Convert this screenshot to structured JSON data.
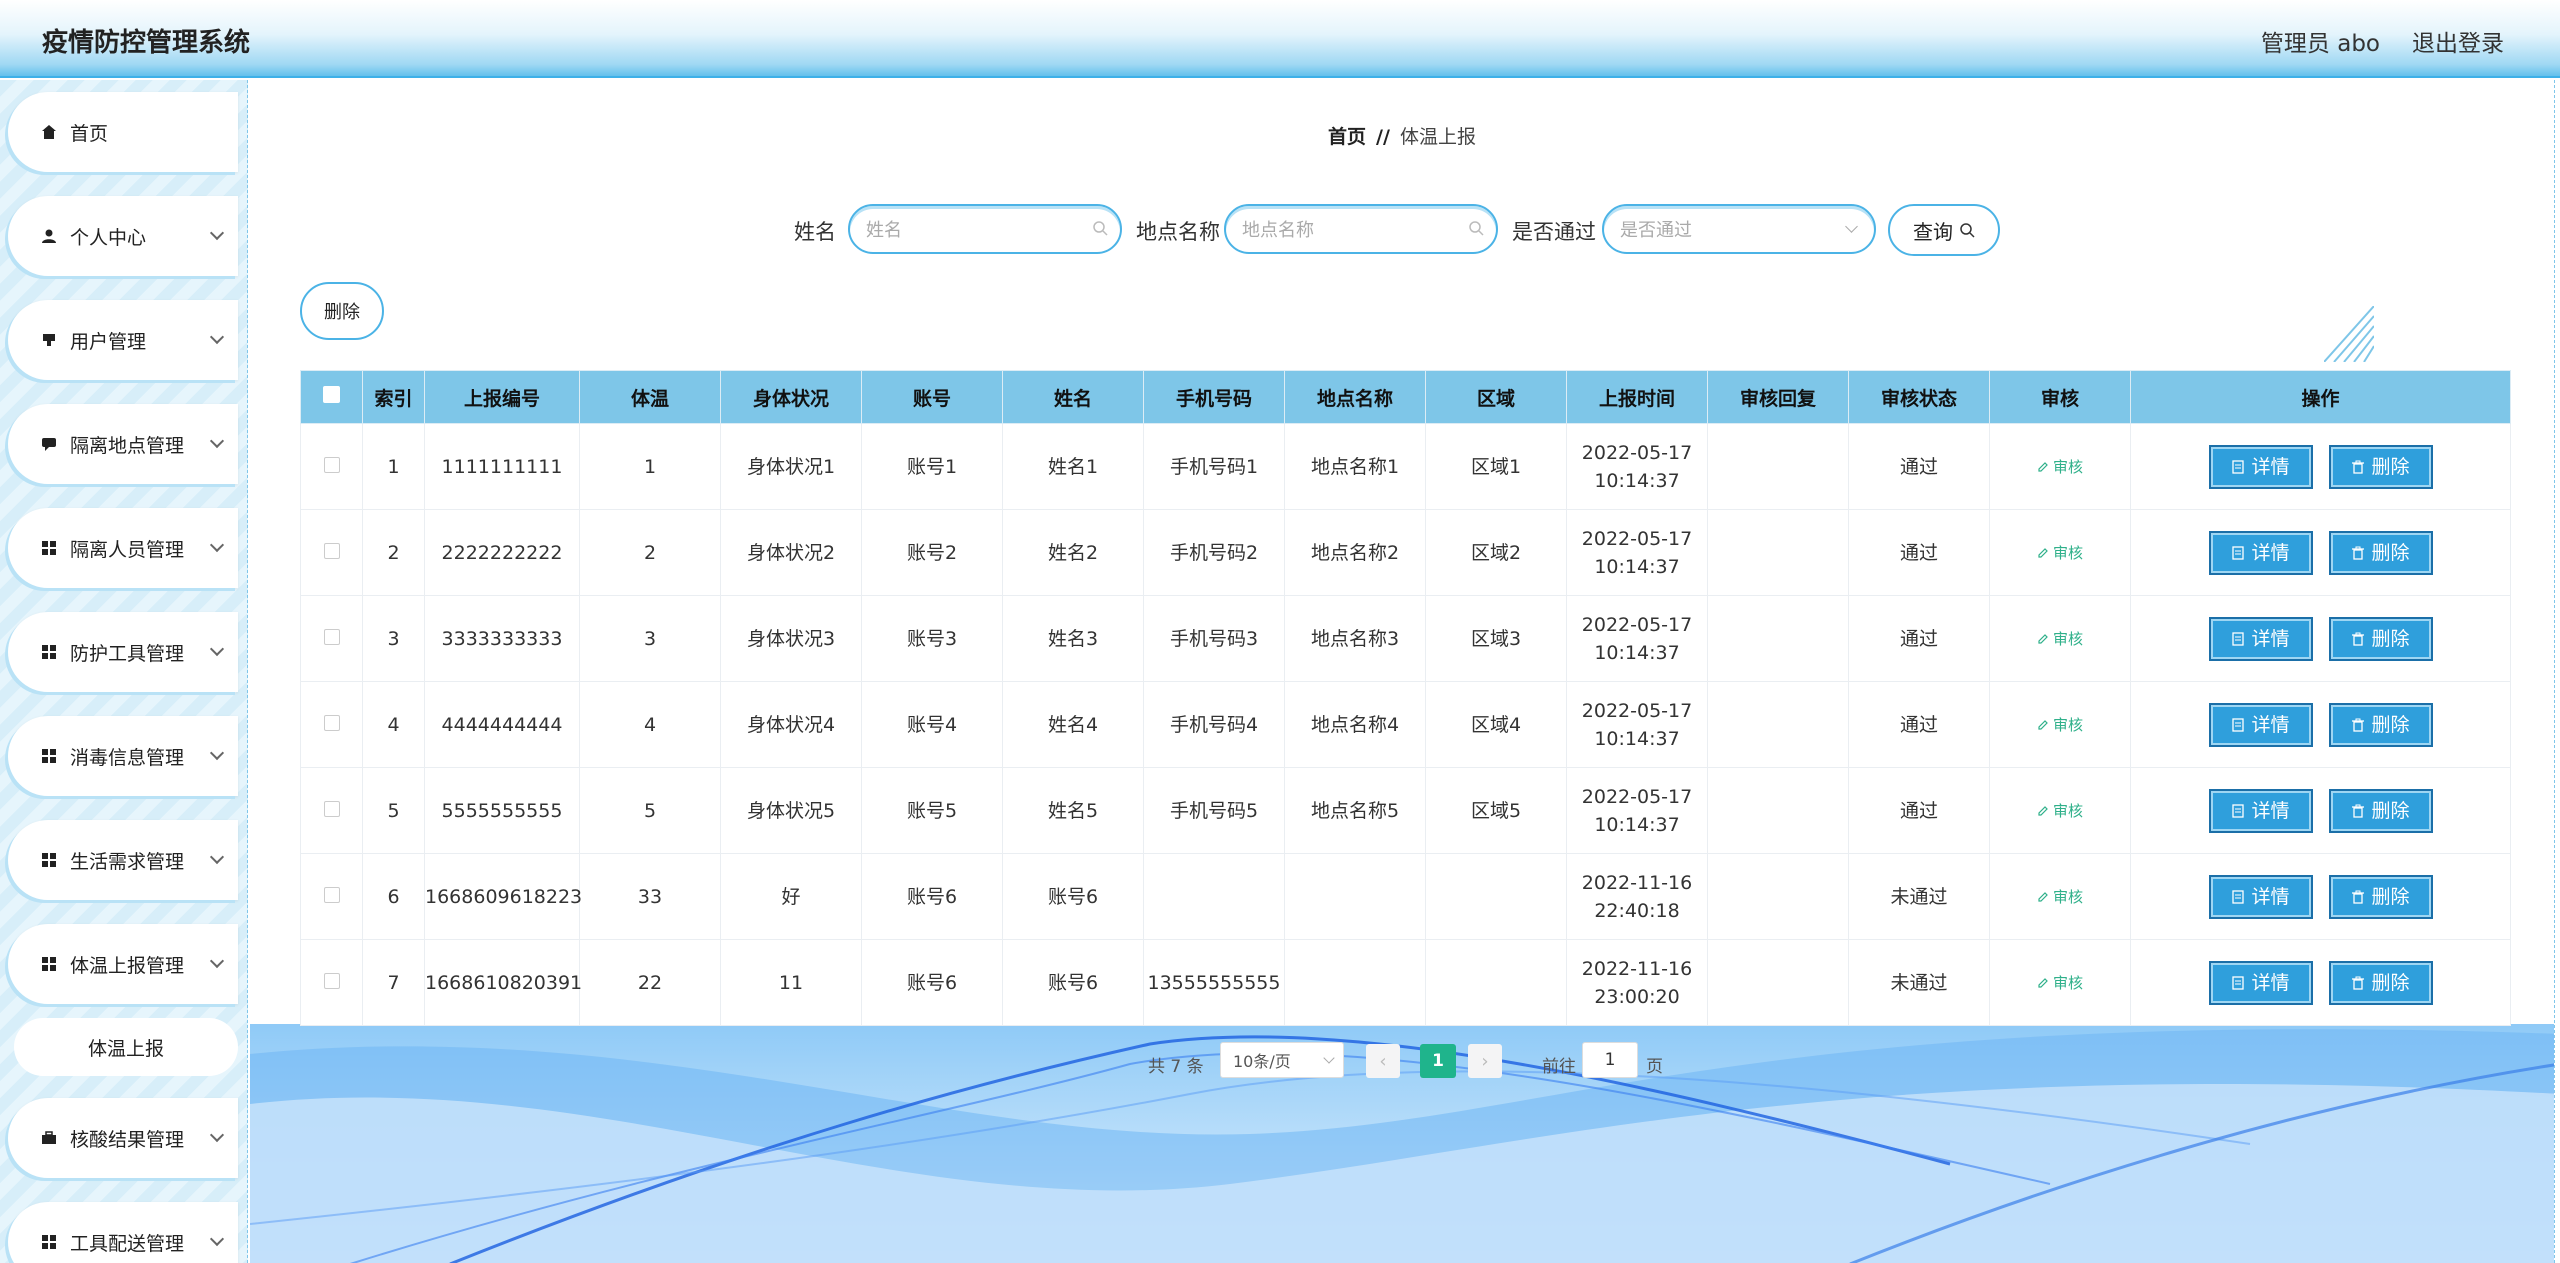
{
  "header": {
    "title": "疫情防控管理系统",
    "user": "管理员 abo",
    "logout": "退出登录"
  },
  "sidebar": {
    "items": [
      {
        "label": "首页",
        "icon": "home-icon"
      },
      {
        "label": "个人中心",
        "icon": "user-icon"
      },
      {
        "label": "用户管理",
        "icon": "stamp-icon"
      },
      {
        "label": "隔离地点管理",
        "icon": "chat-icon"
      },
      {
        "label": "隔离人员管理",
        "icon": "grid-icon"
      },
      {
        "label": "防护工具管理",
        "icon": "grid-icon"
      },
      {
        "label": "消毒信息管理",
        "icon": "grid-icon"
      },
      {
        "label": "生活需求管理",
        "icon": "grid-icon"
      },
      {
        "label": "体温上报管理",
        "icon": "grid-icon"
      },
      {
        "label": "核酸结果管理",
        "icon": "briefcase-icon"
      },
      {
        "label": "工具配送管理",
        "icon": "grid-icon"
      }
    ],
    "submenu": {
      "label": "体温上报"
    }
  },
  "breadcrumb": {
    "home": "首页",
    "sep": "//",
    "current": "体温上报"
  },
  "filters": {
    "name_label": "姓名",
    "name_placeholder": "姓名",
    "place_label": "地点名称",
    "place_placeholder": "地点名称",
    "pass_label": "是否通过",
    "pass_placeholder": "是否通过",
    "query_label": "查询"
  },
  "bulk_delete": "删除",
  "table": {
    "headers": [
      "索引",
      "上报编号",
      "体温",
      "身体状况",
      "账号",
      "姓名",
      "手机号码",
      "地点名称",
      "区域",
      "上报时间",
      "审核回复",
      "审核状态",
      "审核",
      "操作"
    ],
    "rows": [
      {
        "idx": "1",
        "no": "1111111111",
        "temp": "1",
        "body": "身体状况1",
        "acct": "账号1",
        "name": "姓名1",
        "phone": "手机号码1",
        "place": "地点名称1",
        "area": "区域1",
        "time": "2022-05-17 10:14:37",
        "reply": "",
        "status": "通过"
      },
      {
        "idx": "2",
        "no": "2222222222",
        "temp": "2",
        "body": "身体状况2",
        "acct": "账号2",
        "name": "姓名2",
        "phone": "手机号码2",
        "place": "地点名称2",
        "area": "区域2",
        "time": "2022-05-17 10:14:37",
        "reply": "",
        "status": "通过"
      },
      {
        "idx": "3",
        "no": "3333333333",
        "temp": "3",
        "body": "身体状况3",
        "acct": "账号3",
        "name": "姓名3",
        "phone": "手机号码3",
        "place": "地点名称3",
        "area": "区域3",
        "time": "2022-05-17 10:14:37",
        "reply": "",
        "status": "通过"
      },
      {
        "idx": "4",
        "no": "4444444444",
        "temp": "4",
        "body": "身体状况4",
        "acct": "账号4",
        "name": "姓名4",
        "phone": "手机号码4",
        "place": "地点名称4",
        "area": "区域4",
        "time": "2022-05-17 10:14:37",
        "reply": "",
        "status": "通过"
      },
      {
        "idx": "5",
        "no": "5555555555",
        "temp": "5",
        "body": "身体状况5",
        "acct": "账号5",
        "name": "姓名5",
        "phone": "手机号码5",
        "place": "地点名称5",
        "area": "区域5",
        "time": "2022-05-17 10:14:37",
        "reply": "",
        "status": "通过"
      },
      {
        "idx": "6",
        "no": "1668609618223",
        "temp": "33",
        "body": "好",
        "acct": "账号6",
        "name": "账号6",
        "phone": "",
        "place": "",
        "area": "",
        "time": "2022-11-16 22:40:18",
        "reply": "",
        "status": "未通过"
      },
      {
        "idx": "7",
        "no": "1668610820391",
        "temp": "22",
        "body": "11",
        "acct": "账号6",
        "name": "账号6",
        "phone": "13555555555",
        "place": "",
        "area": "",
        "time": "2022-11-16 23:00:20",
        "reply": "",
        "status": "未通过"
      }
    ],
    "audit_label": "审核",
    "detail_label": "详情",
    "delete_label": "删除"
  },
  "pagination": {
    "total": "共 7 条",
    "page_size": "10条/页",
    "current": "1",
    "goto_label": "前往",
    "goto_value": "1",
    "page_unit": "页"
  },
  "colors": {
    "accent": "#2f9fdc",
    "header": "#7ec6e8",
    "active_page": "#1fb48c",
    "audit": "#2fb08a"
  }
}
